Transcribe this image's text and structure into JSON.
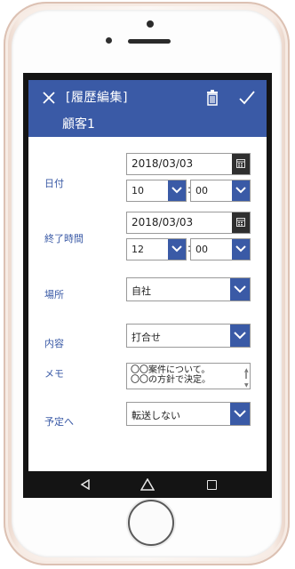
{
  "header": {
    "title": "[履歴編集]",
    "subtitle": "顧客1"
  },
  "form": {
    "date": {
      "label": "日付",
      "value": "2018/03/03",
      "hour": "10",
      "minute": "00"
    },
    "end_time": {
      "label": "終了時間",
      "value": "2018/03/03",
      "hour": "12",
      "minute": "00"
    },
    "place": {
      "label": "場所",
      "value": "自社"
    },
    "content": {
      "label": "内容",
      "value": "打合せ"
    },
    "memo": {
      "label": "メモ",
      "line1": "〇〇案件について。",
      "line2": "〇〇の方針で決定。"
    },
    "plan": {
      "label": "予定へ",
      "value": "転送しない"
    },
    "time_separator": ":"
  },
  "colors": {
    "accent": "#3a5aa6",
    "calendar_button": "#2f2f2f",
    "nav_bar": "#141414"
  },
  "icons": {
    "close": "close-icon",
    "delete": "trash-icon",
    "save": "check-icon",
    "calendar": "calendar-icon",
    "dropdown": "chevron-down-icon",
    "nav_back": "back-triangle-icon",
    "nav_home": "home-icon",
    "nav_recent": "recent-apps-icon"
  }
}
